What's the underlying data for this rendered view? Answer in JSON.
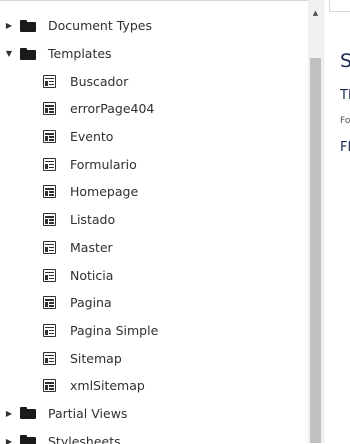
{
  "tree": {
    "items": [
      {
        "label": "Document Types",
        "level": 0,
        "type": "folder",
        "expanded": false
      },
      {
        "label": "Templates",
        "level": 0,
        "type": "folder",
        "expanded": true
      },
      {
        "label": "Buscador",
        "level": 1,
        "type": "template"
      },
      {
        "label": "errorPage404",
        "level": 1,
        "type": "template"
      },
      {
        "label": "Evento",
        "level": 1,
        "type": "template"
      },
      {
        "label": "Formulario",
        "level": 1,
        "type": "template"
      },
      {
        "label": "Homepage",
        "level": 1,
        "type": "template"
      },
      {
        "label": "Listado",
        "level": 1,
        "type": "template"
      },
      {
        "label": "Master",
        "level": 1,
        "type": "template"
      },
      {
        "label": "Noticia",
        "level": 1,
        "type": "template"
      },
      {
        "label": "Pagina",
        "level": 1,
        "type": "template"
      },
      {
        "label": "Pagina Simple",
        "level": 1,
        "type": "template"
      },
      {
        "label": "Sitemap",
        "level": 1,
        "type": "template"
      },
      {
        "label": "xmlSitemap",
        "level": 1,
        "type": "template"
      },
      {
        "label": "Partial Views",
        "level": 0,
        "type": "folder",
        "expanded": false
      },
      {
        "label": "Stylesheets",
        "level": 0,
        "type": "folder",
        "expanded": false
      }
    ]
  },
  "right_panel": {
    "line1": "S",
    "line2": "Tl",
    "line3": "Fo",
    "line4": "Fl"
  },
  "icons": {
    "caret_collapsed": "caret-right-icon",
    "caret_expanded": "caret-down-icon",
    "folder": "folder-icon",
    "template": "template-icon",
    "scroll_up": "scroll-up-arrow-icon"
  },
  "colors": {
    "text": "#303033",
    "scroll_thumb": "#c1c1c1",
    "scroll_track": "#f1f1f1"
  }
}
